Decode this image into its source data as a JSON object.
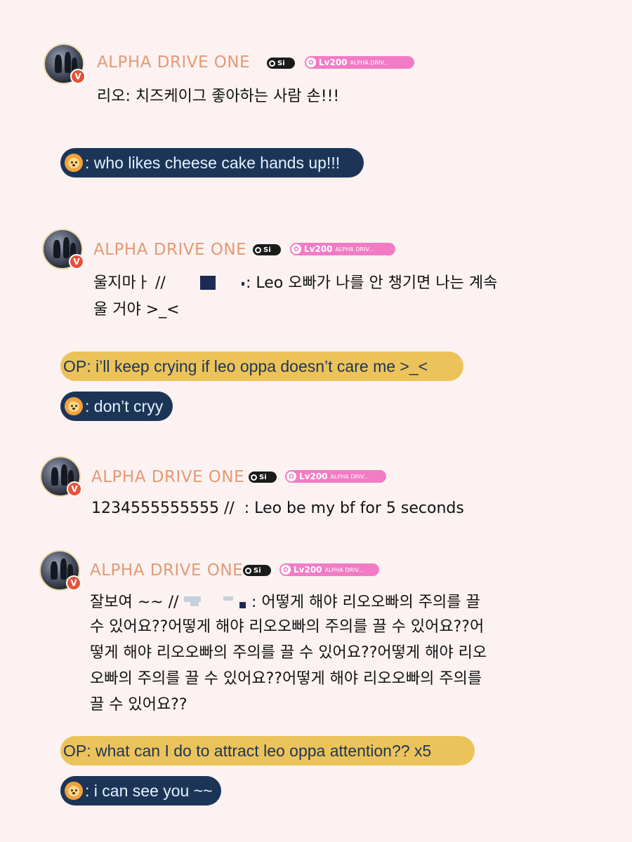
{
  "posts": [
    {
      "username": "ALPHA DRIVE ONE",
      "badge_text": "Si",
      "level": "Lv200",
      "level_name": "ALPHA DRIV...",
      "lines": [
        "리오: 치즈케이그 좋아하는 사람 손!!!"
      ]
    },
    {
      "username": "ALPHA DRIVE ONE",
      "badge_text": "Si",
      "level": "Lv200",
      "level_name": "ALPHA DRIV...",
      "line1_prefix": "울지마ㅏ //",
      "line1_suffix": ": Leo 오빠가 나를 안 챙기면 나는 계속",
      "line2": "울 거야 >_<"
    },
    {
      "username": "ALPHA DRIVE ONE",
      "badge_text": "Si",
      "level": "Lv200",
      "level_name": "ALPHA DRIV...",
      "lines": [
        "1234555555555 //  : Leo be my bf for 5 seconds"
      ]
    },
    {
      "username": "ALPHA DRIVE ONE",
      "badge_text": "Si",
      "level": "Lv200",
      "level_name": "ALPHA DRIV...",
      "line1_prefix": "잘보여 ~~ //",
      "line1_suffix": ": 어떻게 해야 리오오빠의 주의를 끌",
      "lines": [
        "수 있어요??어떻게 해야 리오오빠의 주의를 끌 수 있어요??어",
        "떻게 해야 리오오빠의 주의를 끌 수 있어요??어떻게 해야 리오",
        "오빠의 주의를 끌 수 있어요??어떻게 해야 리오오빠의 주의를",
        "끌 수 있어요??"
      ]
    }
  ],
  "translations": {
    "t1": ": who likes cheese cake hands up!!!",
    "t2_op": "OP: i’ll keep crying if leo oppa doesn’t care me >_<",
    "t2_reply": ": don’t cryy",
    "t3_op": "OP: what can I do to attract leo oppa attention?? x5",
    "t3_reply": ": i can see you ~~"
  },
  "icons": {
    "reply_icon": "lion-face-icon",
    "verified_badge": "V"
  },
  "colors": {
    "background": "#fcf2f2",
    "username": "#e39a74",
    "navy_pill": "#1c3557",
    "gold_pill": "#ecc35a",
    "level_badge": "#f27bc5"
  }
}
